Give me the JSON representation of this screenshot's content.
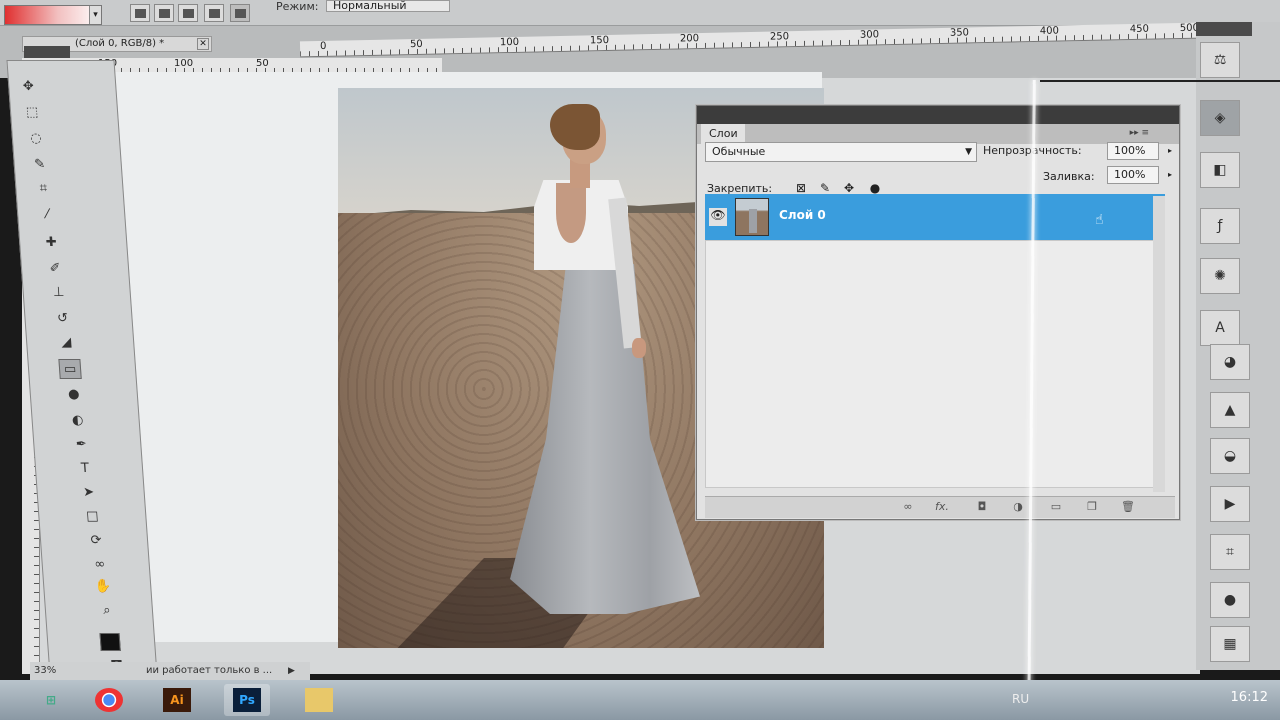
{
  "options_bar": {
    "mode_label": "Режим:",
    "mode_value": "Нормальный"
  },
  "document": {
    "tab_title": "(Слой 0, RGB/8) *",
    "tab_close": "✕"
  },
  "rulers": {
    "top": [
      "0",
      "50",
      "100",
      "150",
      "200",
      "250",
      "300",
      "350",
      "400",
      "450",
      "500"
    ],
    "second": [
      "150",
      "100",
      "50"
    ]
  },
  "layers_panel": {
    "tab": "Слои",
    "blend_mode": "Обычные",
    "opacity_label": "Непрозрачность:",
    "opacity_value": "100%",
    "fill_label": "Заливка:",
    "fill_value": "100%",
    "lock_label": "Закрепить:",
    "layer_name": "Слой 0",
    "bottom_icons": [
      "link-icon",
      "fx-icon",
      "mask-icon",
      "adjustment-icon",
      "group-icon",
      "new-layer-icon",
      "trash-icon"
    ],
    "fx_text": "fx."
  },
  "status_bar": {
    "zoom": "33%",
    "message": "ии работает только в ..."
  },
  "taskbar": {
    "ai_label": "Ai",
    "ps_label": "Ps",
    "lang": "RU",
    "clock": "16:12"
  },
  "colors": {
    "selected_layer": "#3a9ddd",
    "panel_bg": "#e2e2e2",
    "canvas_bg": "#d6d8d9"
  }
}
